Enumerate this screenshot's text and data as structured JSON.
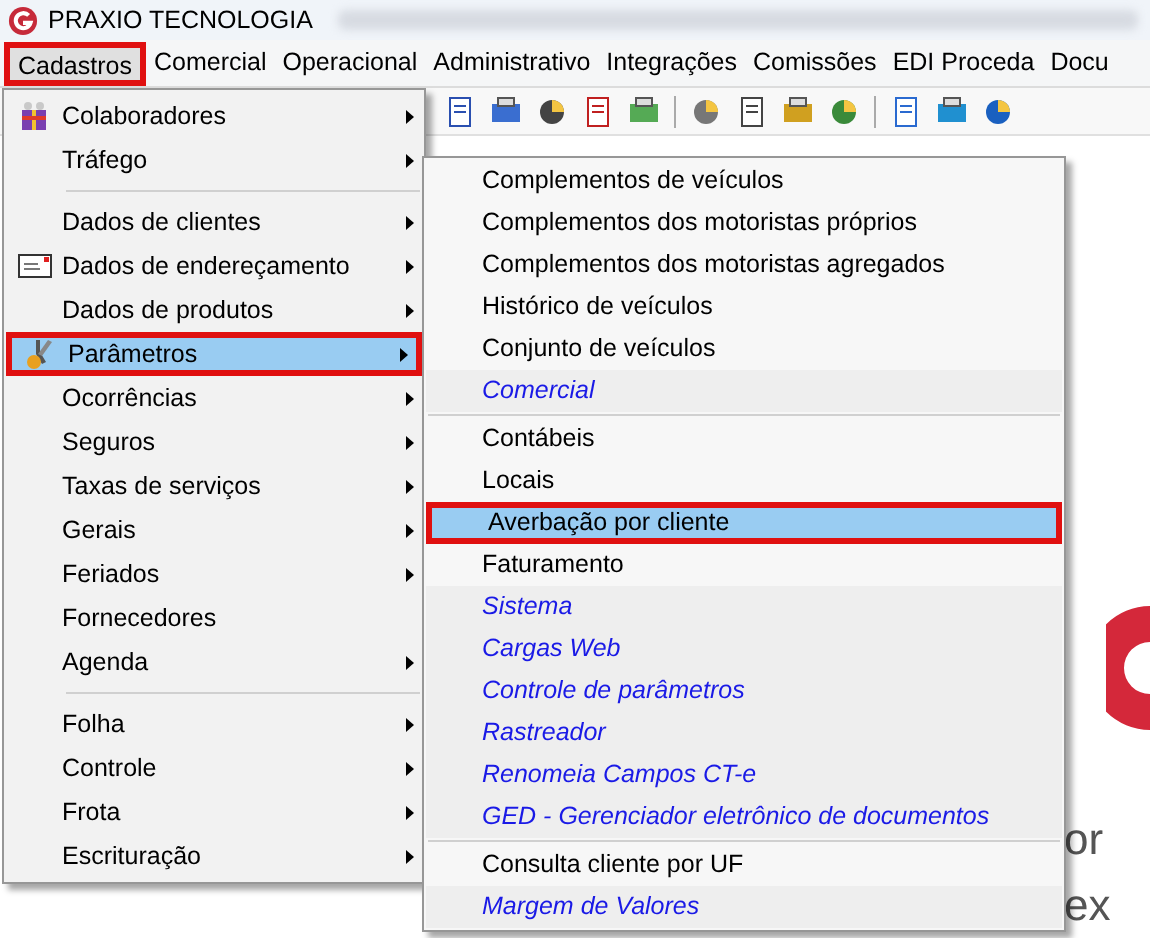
{
  "window": {
    "title": "PRAXIO TECNOLOGIA"
  },
  "menu_bar": [
    {
      "label": "Cadastros",
      "selected": true,
      "outlined": true
    },
    {
      "label": "Comercial",
      "selected": false,
      "outlined": false
    },
    {
      "label": "Operacional",
      "selected": false,
      "outlined": false
    },
    {
      "label": "Administrativo",
      "selected": false,
      "outlined": false
    },
    {
      "label": "Integrações",
      "selected": false,
      "outlined": false
    },
    {
      "label": "Comissões",
      "selected": false,
      "outlined": false
    },
    {
      "label": "EDI Proceda",
      "selected": false,
      "outlined": false
    },
    {
      "label": "Docu",
      "selected": false,
      "outlined": false
    }
  ],
  "cadastros_menu": [
    {
      "label": "Colaboradores",
      "submenu": true,
      "selected": false,
      "outlined": false
    },
    {
      "label": "Tráfego",
      "submenu": true,
      "selected": false,
      "outlined": false,
      "separator_after": true
    },
    {
      "label": "Dados de clientes",
      "submenu": true,
      "selected": false,
      "outlined": false
    },
    {
      "label": "Dados de endereçamento",
      "submenu": true,
      "selected": false,
      "outlined": false
    },
    {
      "label": "Dados de produtos",
      "submenu": true,
      "selected": false,
      "outlined": false
    },
    {
      "label": "Parâmetros",
      "submenu": true,
      "selected": true,
      "outlined": true
    },
    {
      "label": "Ocorrências",
      "submenu": true,
      "selected": false,
      "outlined": false
    },
    {
      "label": "Seguros",
      "submenu": true,
      "selected": false,
      "outlined": false
    },
    {
      "label": "Taxas de serviços",
      "submenu": true,
      "selected": false,
      "outlined": false
    },
    {
      "label": "Gerais",
      "submenu": true,
      "selected": false,
      "outlined": false
    },
    {
      "label": "Feriados",
      "submenu": true,
      "selected": false,
      "outlined": false
    },
    {
      "label": "Fornecedores",
      "submenu": false,
      "selected": false,
      "outlined": false
    },
    {
      "label": "Agenda",
      "submenu": true,
      "selected": false,
      "outlined": false,
      "separator_after": true
    },
    {
      "label": "Folha",
      "submenu": true,
      "selected": false,
      "outlined": false
    },
    {
      "label": "Controle",
      "submenu": true,
      "selected": false,
      "outlined": false
    },
    {
      "label": "Frota",
      "submenu": true,
      "selected": false,
      "outlined": false
    },
    {
      "label": "Escrituração",
      "submenu": true,
      "selected": false,
      "outlined": false
    }
  ],
  "parametros_menu": [
    {
      "label": "Complementos de veículos",
      "kind": "plain",
      "selected": false,
      "outlined": false
    },
    {
      "label": "Complementos dos motoristas próprios",
      "kind": "plain",
      "selected": false,
      "outlined": false
    },
    {
      "label": "Complementos dos motoristas agregados",
      "kind": "plain",
      "selected": false,
      "outlined": false
    },
    {
      "label": "Histórico de veículos",
      "kind": "plain",
      "selected": false,
      "outlined": false
    },
    {
      "label": "Conjunto de veículos",
      "kind": "plain",
      "selected": false,
      "outlined": false
    },
    {
      "label": "Comercial",
      "kind": "link",
      "selected": false,
      "outlined": false,
      "separator_after": true
    },
    {
      "label": "Contábeis",
      "kind": "plain",
      "selected": false,
      "outlined": false
    },
    {
      "label": "Locais",
      "kind": "plain",
      "selected": false,
      "outlined": false
    },
    {
      "label": "Averbação por cliente",
      "kind": "plain",
      "selected": true,
      "outlined": true
    },
    {
      "label": "Faturamento",
      "kind": "plain",
      "selected": false,
      "outlined": false
    },
    {
      "label": "Sistema",
      "kind": "link",
      "selected": false,
      "outlined": false
    },
    {
      "label": "Cargas Web",
      "kind": "link",
      "selected": false,
      "outlined": false
    },
    {
      "label": "Controle de parâmetros",
      "kind": "link",
      "selected": false,
      "outlined": false
    },
    {
      "label": "Rastreador",
      "kind": "link",
      "selected": false,
      "outlined": false
    },
    {
      "label": "Renomeia Campos CT-e",
      "kind": "link",
      "selected": false,
      "outlined": false
    },
    {
      "label": "GED - Gerenciador eletrônico de documentos",
      "kind": "link",
      "selected": false,
      "outlined": false,
      "separator_after": true
    },
    {
      "label": "Consulta cliente por UF",
      "kind": "plain",
      "selected": false,
      "outlined": false
    },
    {
      "label": "Margem de Valores",
      "kind": "link",
      "selected": false,
      "outlined": false
    }
  ],
  "background_text": "or ex"
}
